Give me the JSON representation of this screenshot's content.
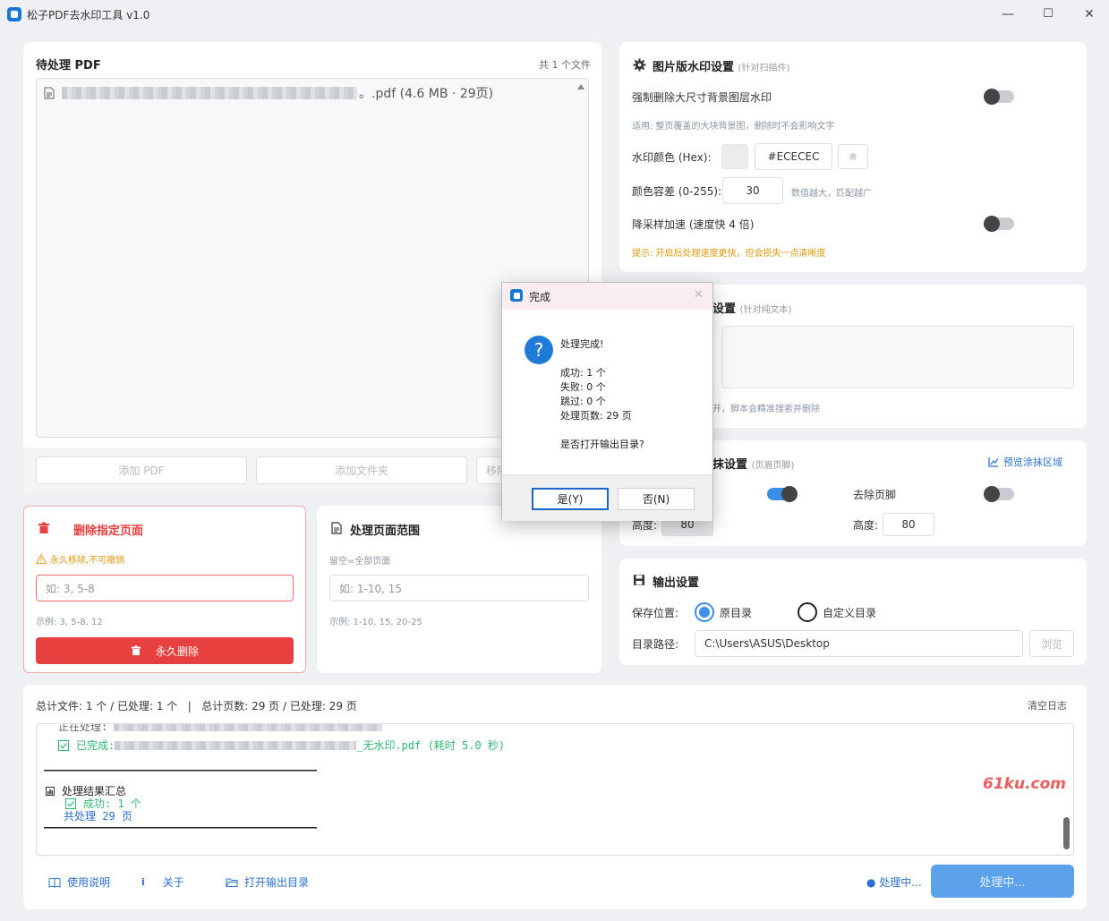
{
  "window": {
    "title": "松子PDF去水印工具 v1.0",
    "min": "—",
    "max": "☐",
    "close": "✕"
  },
  "pending": {
    "title": "待处理 PDF",
    "count": "共 1 个文件",
    "file_suffix": "。.pdf (4.6 MB · 29页)",
    "add_pdf": "添加 PDF",
    "add_folder": "添加文件夹",
    "remove": "移除"
  },
  "image_wm": {
    "title": "图片版水印设置",
    "subtitle": "(针对扫描件)",
    "force_remove_label": "强制删除大尺寸背景图层水印",
    "force_remove_on": false,
    "force_remove_hint": "适用: 整页覆盖的大块背景图，删除时不会影响文字",
    "color_label": "水印颜色 (Hex):",
    "color_value": "#ECECEC",
    "color_swatch": "#ECECEC",
    "tolerance_label": "颜色容差 (0-255):",
    "tolerance_value": "30",
    "tolerance_hint": "数值越大，匹配越广",
    "downsample_label": "降采样加速 (速度快 4 倍)",
    "downsample_on": false,
    "downsample_hint": "提示: 开启后处理速度更快，但会损失一点清晰度"
  },
  "text_wm": {
    "title_tail": "设置",
    "subtitle": "(针对纯文本)",
    "hint_tail": "开，脚本会精准搜索并删除"
  },
  "erase": {
    "title_tail": "抹设置",
    "subtitle": "(页眉页脚)",
    "preview_link": "预览涂抹区域",
    "header_on": true,
    "footer_label": "去除页脚",
    "footer_on": false,
    "height_label": "高度:",
    "header_height": "80",
    "footer_height": "80"
  },
  "delete_pages": {
    "title": "删除指定页面",
    "warning": "永久移除,不可撤销",
    "placeholder": "如: 3, 5-8",
    "example": "示例: 3, 5-8, 12",
    "button": "永久删除"
  },
  "page_range": {
    "title": "处理页面范围",
    "hint": "留空=全部页面",
    "placeholder": "如: 1-10, 15",
    "example": "示例: 1-10, 15, 20-25"
  },
  "output": {
    "title": "输出设置",
    "location_label": "保存位置:",
    "option_original": "原目录",
    "option_custom": "自定义目录",
    "selected": "原目录",
    "path_label": "目录路径:",
    "path_value": "C:\\Users\\ASUS\\Desktop",
    "browse": "浏览"
  },
  "status": {
    "summary": "总计文件: 1 个 / 已处理: 1 个   |   总计页数: 29 页 / 已处理: 29 页",
    "clear_log": "清空日志"
  },
  "log": {
    "partial_line": "正在处理: ",
    "done_prefix": "已完成: ",
    "done_suffix": "_无水印.pdf  (耗时 5.0 秒)",
    "divider": "——————————————————————————————————————————————————————————",
    "summary_title": "处理结果汇总",
    "success": "成功: 1 个",
    "total_pages": "共处理 29 页",
    "divider2": "——————————————————————————————————————————————————————————"
  },
  "footer": {
    "help": "使用说明",
    "about": "关于",
    "open_output": "打开输出目录",
    "status_text": "● 处理中...",
    "process_button": "处理中..."
  },
  "watermark": "61ku.com",
  "dialog": {
    "title": "完成",
    "heading": "处理完成!",
    "success": "成功: 1 个",
    "failed": "失败: 0 个",
    "skipped": "跳过: 0 个",
    "pages": "处理页数: 29 页",
    "question": "是否打开输出目录?",
    "yes": "是(Y)",
    "no": "否(N)"
  },
  "colors": {
    "accent": "#3b8ee8",
    "danger": "#e8403f",
    "warning": "#e09a14",
    "success": "#2eb872"
  },
  "icons": [
    "app-logo-icon",
    "file-icon",
    "gear-icon",
    "trash-icon",
    "document-icon",
    "save-icon",
    "preview-icon",
    "book-icon",
    "info-icon",
    "folder-icon",
    "question-icon",
    "eyedropper-icon",
    "check-icon",
    "chart-icon"
  ]
}
